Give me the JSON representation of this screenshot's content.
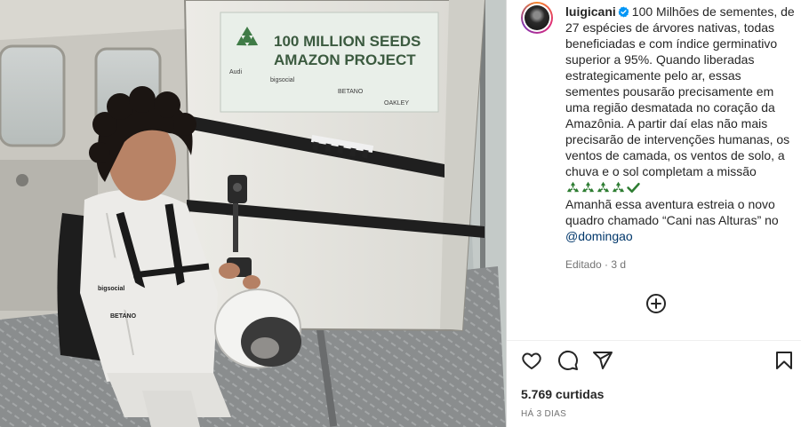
{
  "post": {
    "username": "luigicani",
    "caption_parts": {
      "p1": "100 Milhões de sementes, de 27 espécies de árvores nativas, todas beneficiadas e com índice germinativo superior a 95%. Quando liberadas estrategicamente pelo ar, essas sementes pousarão precisamente em uma região desmatada no coração da Amazônia. A partir daí elas não mais precisarão de intervenções humanas, os ventos de camada, os ventos de solo, a chuva e o sol completam a missão",
      "p2": "Amanhã essa aventura estreia o novo quadro chamado “Cani nas Alturas” no",
      "mention": "@domingao"
    },
    "emojis": [
      "recycle-icon",
      "recycle-icon",
      "recycle-icon",
      "recycle-icon",
      "check-mark-icon"
    ],
    "edited_label": "Editado",
    "edited_time": "3 d",
    "likes_text": "5.769 curtidas",
    "date_text": "HÁ 3 DIAS"
  },
  "photo": {
    "crate_line1": "100 MILLION SEEDS",
    "crate_line2": "AMAZON PROJECT",
    "crate_logos": [
      "Audi",
      "bigsocial",
      "BETANO",
      "OAKLEY"
    ],
    "suit_logos": [
      "bigsocial",
      "BETANO"
    ]
  },
  "icons": {
    "actions_left": [
      "heart-icon",
      "comment-icon",
      "share-icon"
    ],
    "actions_right": [
      "bookmark-icon"
    ],
    "add_comment": "plus-circle-icon",
    "verified": "verified-badge-icon"
  },
  "colors": {
    "verified_blue": "#0095f6",
    "link_blue": "#00376b",
    "emoji_green": "#2e7d32",
    "muted_text": "#737373",
    "border": "#dbdbdb"
  }
}
